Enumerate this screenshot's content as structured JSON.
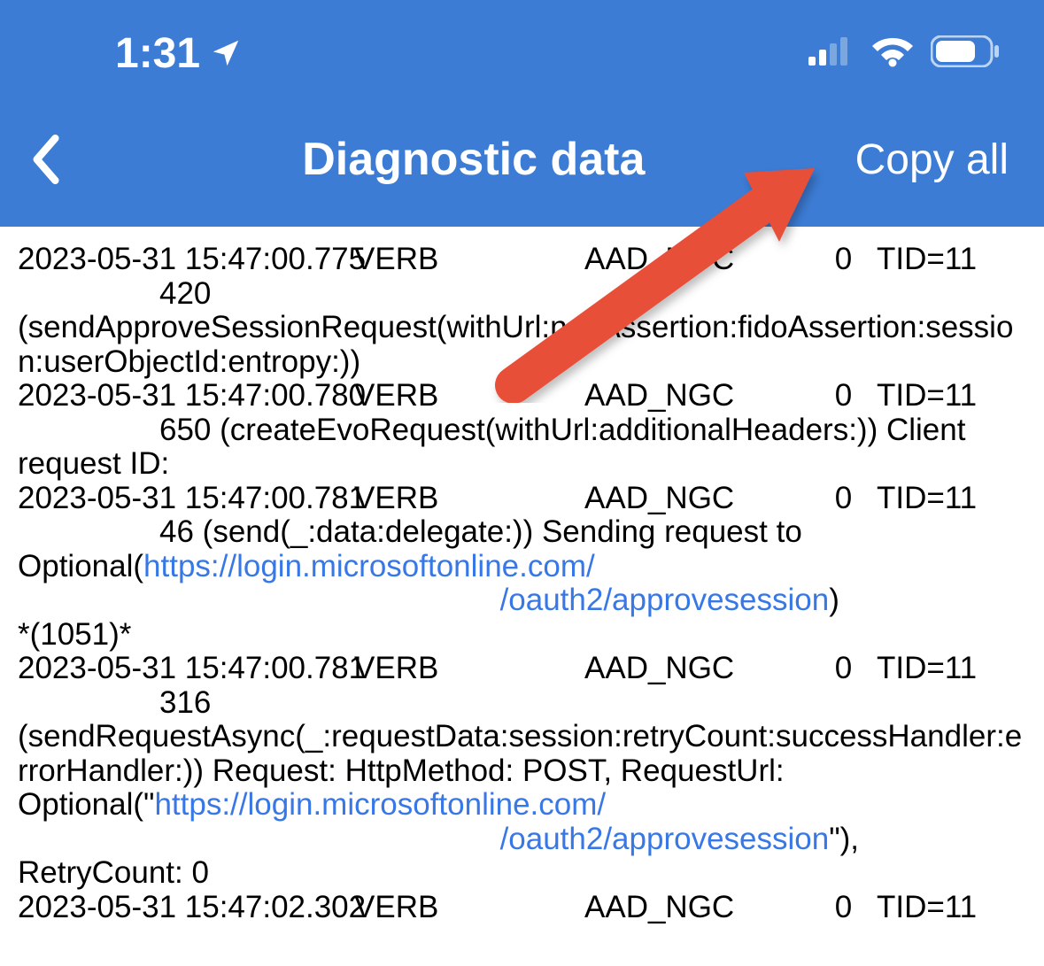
{
  "status": {
    "time": "1:31",
    "location_icon": "location-arrow-icon"
  },
  "nav": {
    "title": "Diagnostic data",
    "copy_all": "Copy all"
  },
  "logs": {
    "entries": [
      {
        "time": "2023-05-31 15:47:00.775",
        "level": "VERB",
        "cat_masked": "AAD_NGC",
        "zero": "0",
        "tid": "TID=11",
        "line_no": "420",
        "msg": "(sendApproveSessionRequest(withUrl:ngcAssertion:fidoAssertion:session:userObjectId:entropy:))"
      },
      {
        "time": "2023-05-31 15:47:00.780",
        "level": "VERB",
        "cat": "AAD_NGC",
        "zero": "0",
        "tid": "TID=11",
        "line_no": "650",
        "msg_a": " (createEvoRequest(withUrl:additionalHeaders:)) Client request ID:"
      },
      {
        "time": "2023-05-31 15:47:00.781",
        "level": "VERB",
        "cat": "AAD_NGC",
        "zero": "0",
        "tid": "TID=11",
        "line_no": "46",
        "msg_prefix": " (send(_:data:delegate:)) Sending request to Optional(",
        "url1": "https://login.microsoftonline.com/",
        "gap": "                                                        ",
        "url2": "/oauth2/approvesession",
        "msg_suffix": ")",
        "extra": "*(1051)*"
      },
      {
        "time": "2023-05-31 15:47:00.781",
        "level": "VERB",
        "cat": "AAD_NGC",
        "zero": "0",
        "tid": "TID=11",
        "line_no": "316",
        "msg_a": "(sendRequestAsync(_:requestData:session:retryCount:successHandler:errorHandler:)) Request: HttpMethod: POST, RequestUrl: Optional(\"",
        "url1": "https://login.microsoftonline.com/",
        "gap": "                                                        ",
        "url2": "/oauth2/approvesession",
        "msg_b": "\"), RetryCount: 0"
      },
      {
        "time": "2023-05-31 15:47:02.302",
        "level": "VERB",
        "cat": "AAD_NGC",
        "zero": "0",
        "tid": "TID=11"
      }
    ]
  }
}
